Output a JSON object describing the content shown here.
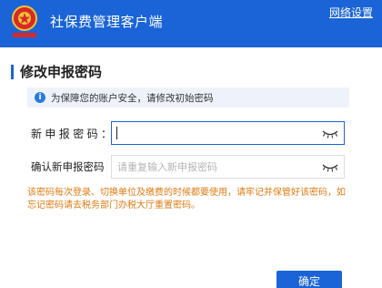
{
  "header": {
    "app_title": "社保费管理客户端",
    "network_settings": "网络设置",
    "logo_icon": "tax-emblem-icon",
    "logo_text": "中国税务"
  },
  "section": {
    "title": "修改申报密码"
  },
  "info": {
    "icon": "info-icon",
    "text": "为保障您的账户安全，请修改初始密码"
  },
  "form": {
    "new_password_label": "新申报密码：",
    "new_password_value": "",
    "confirm_password_label": "确认新申报密码",
    "confirm_password_placeholder": "请重复输入新申报密码",
    "eye_icon": "eye-closed-icon"
  },
  "warning": {
    "text": "该密码每次登录、切换单位及缴费的时候都要使用，请牢记并保管好该密码，如忘记密码请去税务部门办税大厅重置密码。"
  },
  "actions": {
    "confirm_label": "确定"
  },
  "colors": {
    "brand": "#1a64d8",
    "warning": "#e07b12",
    "banner_bg": "#eef3fb"
  }
}
